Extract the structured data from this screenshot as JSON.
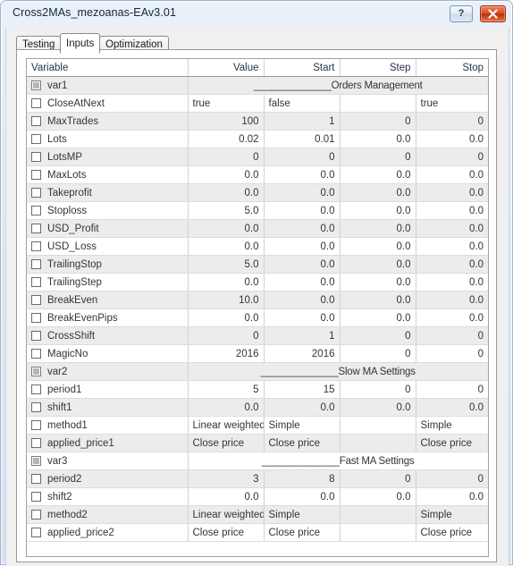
{
  "window": {
    "title": "Cross2MAs_mezoanas-EAv3.01",
    "help_button_label": "?",
    "close_button_label": "close-icon"
  },
  "tabs": [
    {
      "label": "Testing",
      "active": false
    },
    {
      "label": "Inputs",
      "active": true
    },
    {
      "label": "Optimization",
      "active": false
    }
  ],
  "grid": {
    "columns": [
      "Variable",
      "Value",
      "Start",
      "Step",
      "Stop"
    ],
    "rows": [
      {
        "variable": "var1",
        "kind": "section",
        "checkbox": "disabled",
        "section_label": "______________Orders Management"
      },
      {
        "variable": "CloseAtNext",
        "kind": "text",
        "checkbox": "unchecked",
        "value": "true",
        "start": "false",
        "step": "",
        "stop": "true"
      },
      {
        "variable": "MaxTrades",
        "kind": "num",
        "checkbox": "unchecked",
        "value": "100",
        "start": "1",
        "step": "0",
        "stop": "0"
      },
      {
        "variable": "Lots",
        "kind": "num",
        "checkbox": "unchecked",
        "value": "0.02",
        "start": "0.01",
        "step": "0.0",
        "stop": "0.0"
      },
      {
        "variable": "LotsMP",
        "kind": "num",
        "checkbox": "unchecked",
        "value": "0",
        "start": "0",
        "step": "0",
        "stop": "0"
      },
      {
        "variable": "MaxLots",
        "kind": "num",
        "checkbox": "unchecked",
        "value": "0.0",
        "start": "0.0",
        "step": "0.0",
        "stop": "0.0"
      },
      {
        "variable": "Takeprofit",
        "kind": "num",
        "checkbox": "unchecked",
        "value": "0.0",
        "start": "0.0",
        "step": "0.0",
        "stop": "0.0"
      },
      {
        "variable": "Stoploss",
        "kind": "num",
        "checkbox": "unchecked",
        "value": "5.0",
        "start": "0.0",
        "step": "0.0",
        "stop": "0.0"
      },
      {
        "variable": "USD_Profit",
        "kind": "num",
        "checkbox": "unchecked",
        "value": "0.0",
        "start": "0.0",
        "step": "0.0",
        "stop": "0.0"
      },
      {
        "variable": "USD_Loss",
        "kind": "num",
        "checkbox": "unchecked",
        "value": "0.0",
        "start": "0.0",
        "step": "0.0",
        "stop": "0.0"
      },
      {
        "variable": "TrailingStop",
        "kind": "num",
        "checkbox": "unchecked",
        "value": "5.0",
        "start": "0.0",
        "step": "0.0",
        "stop": "0.0"
      },
      {
        "variable": "TrailingStep",
        "kind": "num",
        "checkbox": "unchecked",
        "value": "0.0",
        "start": "0.0",
        "step": "0.0",
        "stop": "0.0"
      },
      {
        "variable": "BreakEven",
        "kind": "num",
        "checkbox": "unchecked",
        "value": "10.0",
        "start": "0.0",
        "step": "0.0",
        "stop": "0.0"
      },
      {
        "variable": "BreakEvenPips",
        "kind": "num",
        "checkbox": "unchecked",
        "value": "0.0",
        "start": "0.0",
        "step": "0.0",
        "stop": "0.0"
      },
      {
        "variable": "CrossShift",
        "kind": "num",
        "checkbox": "unchecked",
        "value": "0",
        "start": "1",
        "step": "0",
        "stop": "0"
      },
      {
        "variable": "MagicNo",
        "kind": "num",
        "checkbox": "unchecked",
        "value": "2016",
        "start": "2016",
        "step": "0",
        "stop": "0"
      },
      {
        "variable": "var2",
        "kind": "section",
        "checkbox": "disabled",
        "section_label": "______________Slow MA Settings"
      },
      {
        "variable": "period1",
        "kind": "num",
        "checkbox": "unchecked",
        "value": "5",
        "start": "15",
        "step": "0",
        "stop": "0"
      },
      {
        "variable": "shift1",
        "kind": "num",
        "checkbox": "unchecked",
        "value": "0.0",
        "start": "0.0",
        "step": "0.0",
        "stop": "0.0"
      },
      {
        "variable": "method1",
        "kind": "text",
        "checkbox": "unchecked",
        "value": "Linear weighted",
        "start": "Simple",
        "step": "",
        "stop": "Simple"
      },
      {
        "variable": "applied_price1",
        "kind": "text",
        "checkbox": "unchecked",
        "value": "Close price",
        "start": "Close price",
        "step": "",
        "stop": "Close price"
      },
      {
        "variable": "var3",
        "kind": "section",
        "checkbox": "disabled",
        "section_label": "______________Fast MA Settings"
      },
      {
        "variable": "period2",
        "kind": "num",
        "checkbox": "unchecked",
        "value": "3",
        "start": "8",
        "step": "0",
        "stop": "0"
      },
      {
        "variable": "shift2",
        "kind": "num",
        "checkbox": "unchecked",
        "value": "0.0",
        "start": "0.0",
        "step": "0.0",
        "stop": "0.0"
      },
      {
        "variable": "method2",
        "kind": "text",
        "checkbox": "unchecked",
        "value": "Linear weighted",
        "start": "Simple",
        "step": "",
        "stop": "Simple"
      },
      {
        "variable": "applied_price2",
        "kind": "text",
        "checkbox": "unchecked",
        "value": "Close price",
        "start": "Close price",
        "step": "",
        "stop": "Close price"
      }
    ]
  }
}
